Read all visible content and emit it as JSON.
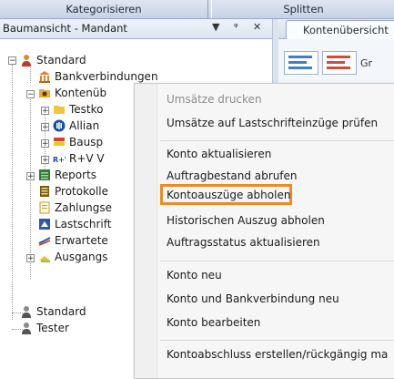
{
  "toolbar": {
    "categorize_label": "Kategorisieren",
    "split_label": "Splitten"
  },
  "panel": {
    "title": "Baumansicht - Mandant",
    "dropdown_glyph": "▼",
    "pin_glyph": "ᵠ",
    "close_glyph": "✕"
  },
  "right": {
    "tab_label": "Kontenübersicht",
    "ribbon_partial_text": "Gr"
  },
  "tree": {
    "nodes": [
      {
        "label": "Standard",
        "icon": "user-icon"
      },
      {
        "label": "Bankverbindungen",
        "icon": "bank-icon"
      },
      {
        "label": "Kontenüb",
        "icon": "accounts-folder-icon"
      },
      {
        "label": "Testko",
        "icon": "folder-icon"
      },
      {
        "label": "Allian",
        "icon": "allianz-icon"
      },
      {
        "label": "Bausp",
        "icon": "bauspar-icon"
      },
      {
        "label": "R+V V",
        "icon": "ruv-icon"
      },
      {
        "label": "Reports",
        "icon": "reports-icon"
      },
      {
        "label": "Protokolle",
        "icon": "log-icon"
      },
      {
        "label": "Zahlungse",
        "icon": "payment-icon"
      },
      {
        "label": "Lastschrift",
        "icon": "direct-debit-icon"
      },
      {
        "label": "Erwartete",
        "icon": "expected-icon"
      },
      {
        "label": "Ausgangs",
        "icon": "outbox-icon"
      },
      {
        "label": "Standard",
        "icon": "user-icon"
      },
      {
        "label": "Tester",
        "icon": "user-icon"
      }
    ]
  },
  "menu": {
    "items": [
      {
        "label": "Umsätze drucken",
        "enabled": false
      },
      {
        "label": "Umsätze auf Lastschrifteinzüge prüfen",
        "enabled": true
      },
      {
        "label": "Konto aktualisieren",
        "enabled": true
      },
      {
        "label": "Auftragbestand abrufen",
        "enabled": true
      },
      {
        "label": "Kontoauszüge abholen",
        "enabled": true,
        "highlighted": true
      },
      {
        "label": "Historischen Auszug abholen",
        "enabled": true
      },
      {
        "label": "Auftragsstatus aktualisieren",
        "enabled": true
      },
      {
        "label": "Konto neu",
        "enabled": true
      },
      {
        "label": "Konto und Bankverbindung neu",
        "enabled": true
      },
      {
        "label": "Konto bearbeiten",
        "enabled": true
      },
      {
        "label": "Kontoabschluss erstellen/rückgängig ma",
        "enabled": true
      }
    ],
    "highlight_color": "#ee8a23"
  }
}
